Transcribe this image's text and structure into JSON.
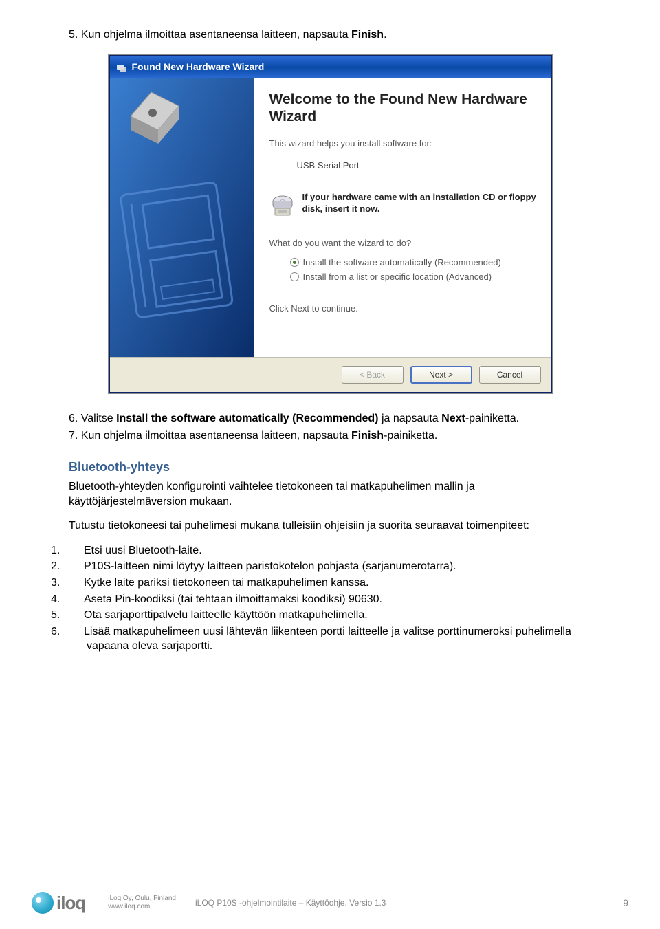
{
  "step5": {
    "num": "5.",
    "prefix": "Kun ohjelma ilmoittaa asentaneensa laitteen, napsauta ",
    "bold": "Finish",
    "suffix": "."
  },
  "wizard": {
    "title": "Found New Hardware Wizard",
    "heading": "Welcome to the Found New Hardware Wizard",
    "helps": "This wizard helps you install software for:",
    "device": "USB Serial Port",
    "cd_text": "If your hardware came with an installation CD or floppy disk, insert it now.",
    "question": "What do you want the wizard to do?",
    "radio1": "Install the software automatically (Recommended)",
    "radio2": "Install from a list or specific location (Advanced)",
    "continue": "Click Next to continue.",
    "back": "< Back",
    "next": "Next >",
    "cancel": "Cancel"
  },
  "step6": {
    "num": "6.",
    "p1": "Valitse ",
    "b1": "Install the software automatically (Recommended) ",
    "p2": "ja napsauta ",
    "b2": "Next",
    "p3": "-painiketta."
  },
  "step7": {
    "num": "7.",
    "p1": "Kun ohjelma ilmoittaa asentaneensa laitteen, napsauta ",
    "b1": "Finish",
    "p2": "-painiketta."
  },
  "bt": {
    "heading": "Bluetooth-yhteys",
    "p1": "Bluetooth-yhteyden konfigurointi vaihtelee tietokoneen tai matkapuhelimen mallin ja käyttöjärjestelmäversion mukaan.",
    "p2": "Tutustu tietokoneesi tai puhelimesi mukana tulleisiin ohjeisiin ja suorita seuraavat toimenpiteet:",
    "items": [
      "Etsi uusi Bluetooth-laite.",
      "P10S-laitteen nimi löytyy laitteen paristokotelon pohjasta (sarjanumerotarra).",
      "Kytke laite pariksi tietokoneen tai matkapuhelimen kanssa.",
      "Aseta Pin-koodiksi (tai tehtaan ilmoittamaksi koodiksi) 90630.",
      "Ota sarjaporttipalvelu laitteelle käyttöön matkapuhelimella.",
      "Lisää matkapuhelimeen uusi lähtevän liikenteen portti laitteelle ja valitse porttinumeroksi puhelimella vapaana oleva sarjaportti."
    ]
  },
  "footer": {
    "logo": "iloq",
    "company": "iLoq Oy, Oulu, Finland",
    "url": "www.iloq.com",
    "doc": "iLOQ P10S -ohjelmointilaite – Käyttöohje.  Versio 1.3",
    "page": "9"
  }
}
